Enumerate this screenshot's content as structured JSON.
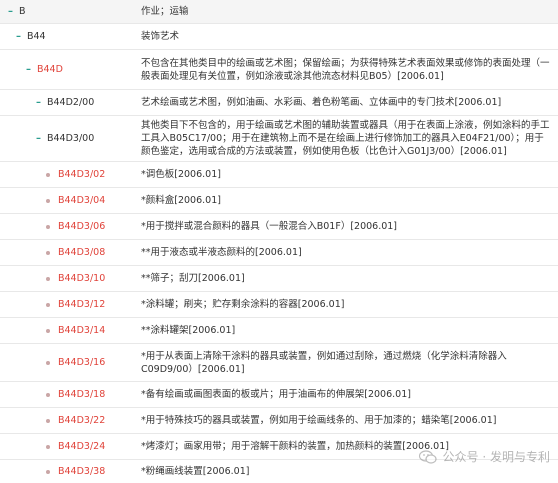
{
  "rows": [
    {
      "code": "B",
      "desc": "作业；运输",
      "marker": "dash",
      "color": "dark"
    },
    {
      "code": "B44",
      "desc": "装饰艺术",
      "marker": "dash",
      "color": "dark"
    },
    {
      "code": "B44D",
      "desc": "不包含在其他类目中的绘画或艺术图；保留绘画；为获得特殊艺术表面效果或修饰的表面处理（一般表面处理见有关位置，例如涂液或涂其他流态材料见B05）[2006.01]",
      "marker": "dash",
      "color": "red"
    },
    {
      "code": "B44D2/00",
      "desc": "艺术绘画或艺术图，例如油画、水彩画、着色粉笔画、立体画中的专门技术[2006.01]",
      "marker": "dash",
      "color": "dark"
    },
    {
      "code": "B44D3/00",
      "desc": "其他类目下不包含的，用于绘画或艺术图的辅助装置或器具（用于在表面上涂液，例如涂料的手工工具入B05C17/00；用于在建筑物上而不是在绘画上进行修饰加工的器具入E04F21/00）；用于颜色鉴定，选用或合成的方法或装置，例如使用色板（比色计入G01J3/00）[2006.01]",
      "marker": "dash",
      "color": "dark"
    },
    {
      "code": "B44D3/02",
      "desc": "*调色板[2006.01]",
      "marker": "dot",
      "color": "red"
    },
    {
      "code": "B44D3/04",
      "desc": "*颜料盒[2006.01]",
      "marker": "dot",
      "color": "red"
    },
    {
      "code": "B44D3/06",
      "desc": "*用于搅拌或混合颜料的器具（一般混合入B01F）[2006.01]",
      "marker": "dot",
      "color": "red"
    },
    {
      "code": "B44D3/08",
      "desc": "**用于液态或半液态颜料的[2006.01]",
      "marker": "dot",
      "color": "red"
    },
    {
      "code": "B44D3/10",
      "desc": "**筛子；刮刀[2006.01]",
      "marker": "dot",
      "color": "red"
    },
    {
      "code": "B44D3/12",
      "desc": "*涂料罐；刷夹；贮存剩余涂料的容器[2006.01]",
      "marker": "dot",
      "color": "red"
    },
    {
      "code": "B44D3/14",
      "desc": "**涂料罐架[2006.01]",
      "marker": "dot",
      "color": "red"
    },
    {
      "code": "B44D3/16",
      "desc": "*用于从表面上清除干涂料的器具或装置，例如通过刮除，通过燃烧（化学涂料清除器入C09D9/00）[2006.01]",
      "marker": "dot",
      "color": "red"
    },
    {
      "code": "B44D3/18",
      "desc": "*备有绘画或画图表面的板或片；用于油画布的伸展架[2006.01]",
      "marker": "dot",
      "color": "red"
    },
    {
      "code": "B44D3/22",
      "desc": "*用于特殊技巧的器具或装置，例如用于绘画线条的、用于加漆的；蜡染笔[2006.01]",
      "marker": "dot",
      "color": "red"
    },
    {
      "code": "B44D3/24",
      "desc": "*烤漆灯；画家用带；用于溶解干颜料的装置，加热颜料的装置[2006.01]",
      "marker": "dot",
      "color": "red"
    },
    {
      "code": "B44D3/38",
      "desc": "*粉绳画线装置[2006.01]",
      "marker": "dot",
      "color": "red"
    }
  ],
  "watermark": {
    "text": "公众号 · 发明与专利",
    "icon": "wechat-icon"
  },
  "colors": {
    "red": "#e0433a",
    "dash": "#2a9d8f",
    "dot": "#c9a6a6"
  }
}
